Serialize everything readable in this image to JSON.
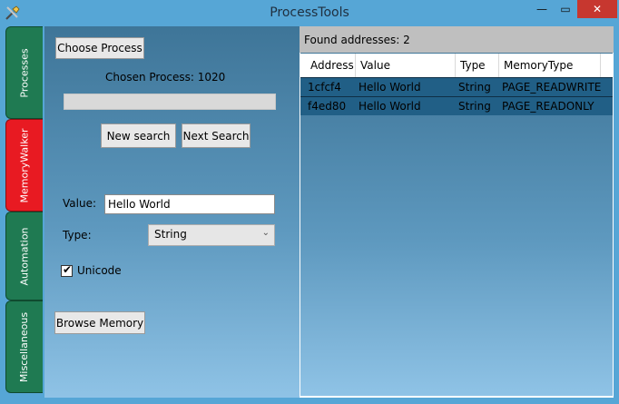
{
  "window": {
    "title": "ProcessTools",
    "controls": {
      "minimize": "—",
      "maximize": "▭",
      "close": "✕"
    }
  },
  "tabs": [
    {
      "label": "Processes",
      "active": false
    },
    {
      "label": "MemoryWalker",
      "active": true
    },
    {
      "label": "Automation",
      "active": false
    },
    {
      "label": "Miscellaneous",
      "active": false
    }
  ],
  "left": {
    "choose_process_label": "Choose Process",
    "chosen_process_text": "Chosen Process: 1020",
    "progress_value": 0,
    "new_search_label": "New search",
    "next_search_label": "Next Search",
    "value_label": "Value:",
    "value_input": "Hello World",
    "type_label": "Type:",
    "type_selected": "String",
    "unicode_label": "Unicode",
    "unicode_checked": true,
    "browse_memory_label": "Browse Memory"
  },
  "right": {
    "found_text": "Found addresses: 2",
    "columns": [
      "Address",
      "Value",
      "Type",
      "MemoryType"
    ],
    "rows": [
      [
        "1cfcf4",
        "Hello World",
        "String",
        "PAGE_READWRITE"
      ],
      [
        "f4ed80",
        "Hello World",
        "String",
        "PAGE_READONLY"
      ]
    ]
  },
  "colors": {
    "accent_tab": "#1f7a52",
    "active_tab": "#e81a22",
    "selected_row": "#215f86"
  },
  "icons": {
    "app": "tools-icon",
    "check": "checkmark-icon",
    "dropdown": "chevron-down-icon"
  }
}
